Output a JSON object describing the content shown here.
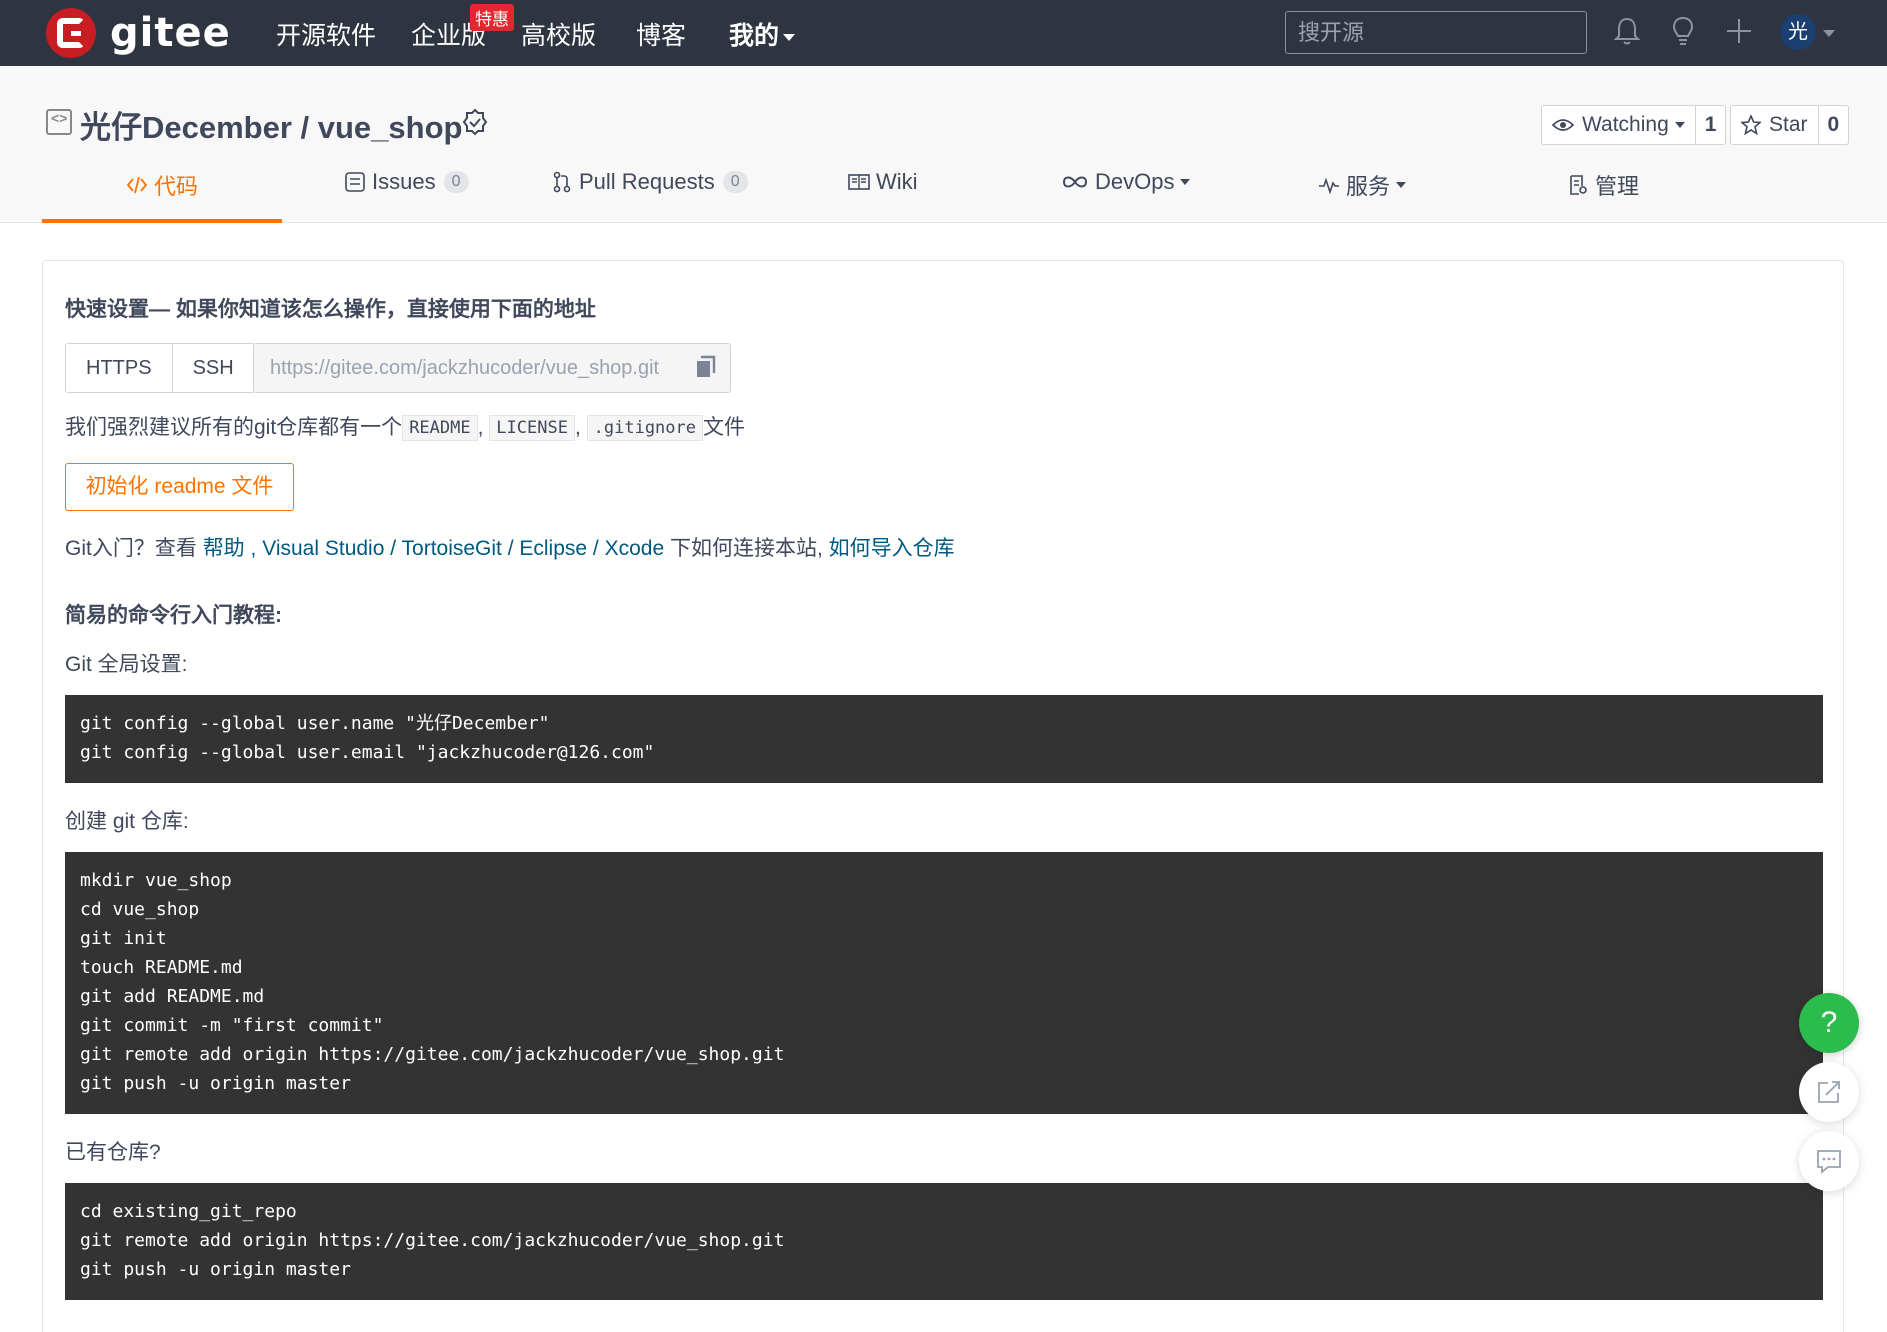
{
  "navbar": {
    "logo_text": "gitee",
    "links": [
      "开源软件",
      "企业版",
      "高校版",
      "博客",
      "我的"
    ],
    "hot_badge": "特惠",
    "search_placeholder": "搜开源",
    "avatar_text": "光"
  },
  "repo": {
    "title": "光仔December / vue_shop",
    "watch_label": "Watching",
    "watch_count": "1",
    "star_label": "Star",
    "star_count": "0"
  },
  "tabs": [
    {
      "label": "代码",
      "count": null
    },
    {
      "label": "Issues",
      "count": "0"
    },
    {
      "label": "Pull Requests",
      "count": "0"
    },
    {
      "label": "Wiki",
      "count": null
    },
    {
      "label": "DevOps",
      "count": null
    },
    {
      "label": "服务",
      "count": null
    },
    {
      "label": "管理",
      "count": null
    }
  ],
  "quick_setup": {
    "heading": "快速设置— 如果你知道该怎么操作，直接使用下面的地址",
    "protocols": [
      "HTTPS",
      "SSH"
    ],
    "clone_url": "https://gitee.com/jackzhucoder/vue_shop.git",
    "recommend_prefix": "我们强烈建议所有的git仓库都有一个",
    "recommend_files": [
      "README",
      "LICENSE",
      ".gitignore"
    ],
    "recommend_sep": ",",
    "recommend_suffix": "文件",
    "init_button": "初始化 readme 文件",
    "help_prefix": "Git入门？查看",
    "help_link": "帮助",
    "tools_link": ", Visual Studio / TortoiseGit / Eclipse / Xcode",
    "help_mid": "下如何连接本站,",
    "import_link": "如何导入仓库"
  },
  "tutorial": {
    "heading": "简易的命令行入门教程:",
    "global_label": "Git 全局设置:",
    "global_code": "git config --global user.name \"光仔December\"\ngit config --global user.email \"jackzhucoder@126.com\"",
    "create_label": "创建 git 仓库:",
    "create_code": "mkdir vue_shop\ncd vue_shop\ngit init\ntouch README.md\ngit add README.md\ngit commit -m \"first commit\"\ngit remote add origin https://gitee.com/jackzhucoder/vue_shop.git\ngit push -u origin master",
    "existing_label": "已有仓库?",
    "existing_code": "cd existing_git_repo\ngit remote add origin https://gitee.com/jackzhucoder/vue_shop.git\ngit push -u origin master"
  },
  "float": {
    "help_label": "?"
  },
  "colors": {
    "navbar_bg": "#2e3440",
    "brand_red": "#c71d23",
    "accent_orange": "#fe7300",
    "link_blue": "#005980",
    "code_bg": "#333333",
    "help_green": "#2cbc4d"
  }
}
